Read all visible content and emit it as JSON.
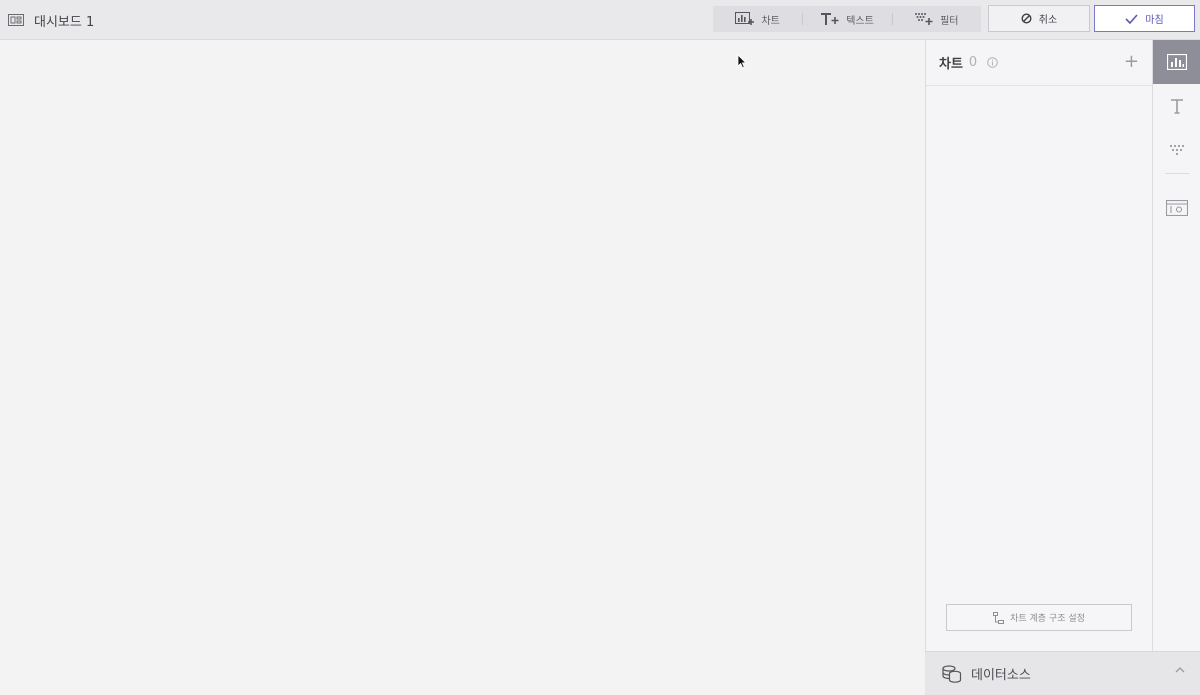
{
  "dashboard": {
    "title": "대시보드 1",
    "icon": "dashboard-icon"
  },
  "toolbar": {
    "tools": [
      {
        "label": "차트",
        "icon": "chart-add-icon"
      },
      {
        "label": "텍스트",
        "icon": "text-add-icon"
      },
      {
        "label": "필터",
        "icon": "filter-add-icon"
      }
    ],
    "cancel_label": "취소",
    "done_label": "마침"
  },
  "panel": {
    "title": "차트",
    "count": "0",
    "add_label": "+",
    "hierarchy_label": "차트 계층 구조 설정"
  },
  "side_tabs": [
    {
      "icon": "chart-icon",
      "active": true
    },
    {
      "icon": "text-icon",
      "active": false
    },
    {
      "icon": "filter-icon",
      "active": false
    },
    {
      "icon": "widget-settings-icon",
      "active": false
    }
  ],
  "datasource": {
    "label": "데이터소스",
    "icon": "database-icon"
  },
  "colors": {
    "accent": "#5c58b8",
    "topbar": "#e9e9ec",
    "active_tab": "#8e8e98"
  }
}
